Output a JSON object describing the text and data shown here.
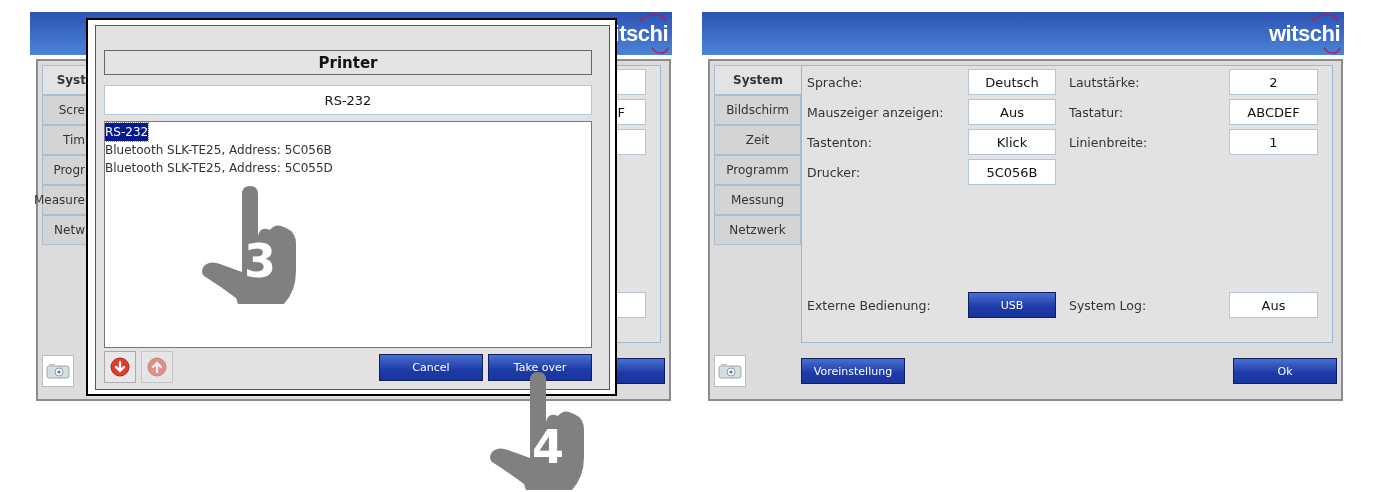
{
  "left_screen": {
    "logo": "itschi",
    "tabs": [
      {
        "label": "Syst",
        "selected": true
      },
      {
        "label": "Scre",
        "selected": false
      },
      {
        "label": "Tim",
        "selected": false
      },
      {
        "label": "Progr",
        "selected": false
      },
      {
        "label": "Measure",
        "selected": false
      },
      {
        "label": "Netw",
        "selected": false
      }
    ],
    "rows": [
      {
        "cells": [
          {
            "kind": "gap"
          },
          {
            "kind": "gap"
          },
          {
            "kind": "gap"
          },
          {
            "kind": "field"
          }
        ]
      },
      {
        "cells": [
          {
            "kind": "gap"
          },
          {
            "kind": "gap"
          },
          {
            "kind": "gap"
          },
          {
            "kind": "field-end",
            "text": "F"
          }
        ]
      },
      {
        "cells": [
          {
            "kind": "gap"
          },
          {
            "kind": "gap"
          },
          {
            "kind": "gap"
          },
          {
            "kind": "field"
          }
        ]
      }
    ],
    "footer_row": {
      "cells": [
        {
          "kind": "gap"
        },
        {
          "kind": "gap"
        },
        {
          "kind": "gap"
        },
        {
          "kind": "field"
        }
      ]
    },
    "footer_buttons": [
      {
        "kind": "ok"
      }
    ]
  },
  "dialog": {
    "title": "Printer",
    "value": "RS-232",
    "options": [
      {
        "label": "RS-232",
        "selected": true
      },
      {
        "label": "Bluetooth SLK-TE25, Address: 5C056B",
        "selected": false
      },
      {
        "label": "Bluetooth SLK-TE25, Address: 5C055D",
        "selected": false
      }
    ],
    "arrow_buttons": [
      {
        "kind": "down",
        "disabled": false
      },
      {
        "kind": "up",
        "disabled": true
      }
    ],
    "buttons": [
      "Cancel",
      "Take over"
    ]
  },
  "annotations": [
    {
      "kind": "list",
      "number": "3"
    },
    {
      "kind": "take-over",
      "number": "4"
    }
  ],
  "right_screen": {
    "logo": "witschi",
    "tabs": [
      {
        "label": "System",
        "selected": true
      },
      {
        "label": "Bildschirm",
        "selected": false
      },
      {
        "label": "Zeit",
        "selected": false
      },
      {
        "label": "Programm",
        "selected": false
      },
      {
        "label": "Messung",
        "selected": false
      },
      {
        "label": "Netzwerk",
        "selected": false
      }
    ],
    "rows": [
      {
        "cells": [
          {
            "kind": "label",
            "text": "Sprache:"
          },
          {
            "kind": "field",
            "text": "Deutsch"
          },
          {
            "kind": "label",
            "text": "Lautstärke:"
          },
          {
            "kind": "field",
            "text": "2"
          }
        ]
      },
      {
        "cells": [
          {
            "kind": "label",
            "text": "Mauszeiger anzeigen:"
          },
          {
            "kind": "field",
            "text": "Aus"
          },
          {
            "kind": "label",
            "text": "Tastatur:"
          },
          {
            "kind": "field",
            "text": "ABCDEF"
          }
        ]
      },
      {
        "cells": [
          {
            "kind": "label",
            "text": "Tastenton:"
          },
          {
            "kind": "field",
            "text": "Klick"
          },
          {
            "kind": "label",
            "text": "Linienbreite:"
          },
          {
            "kind": "field",
            "text": "1"
          }
        ]
      },
      {
        "cells": [
          {
            "kind": "label",
            "text": "Drucker:"
          },
          {
            "kind": "field",
            "text": "5C056B"
          },
          {
            "kind": "gap"
          },
          {
            "kind": "gap"
          }
        ]
      }
    ],
    "footer_row": {
      "cells": [
        {
          "kind": "label",
          "text": "Externe Bedienung:"
        },
        {
          "kind": "button",
          "text": "USB"
        },
        {
          "kind": "label",
          "text": "System Log:"
        },
        {
          "kind": "field",
          "text": "Aus"
        }
      ]
    },
    "footer_buttons": [
      {
        "kind": "preset",
        "label": "Voreinstellung"
      },
      {
        "kind": "ok",
        "label": "Ok"
      }
    ]
  }
}
